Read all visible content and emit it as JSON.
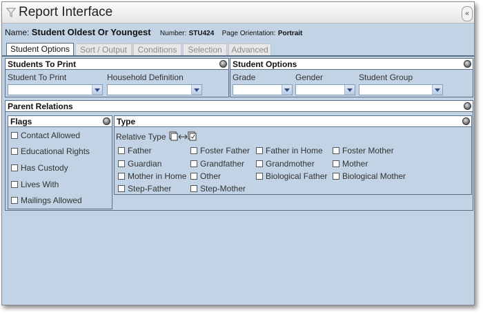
{
  "window": {
    "title": "Report Interface",
    "collapse_label": "«"
  },
  "report": {
    "name_label": "Name:",
    "name": "Student Oldest Or Youngest",
    "number_label": "Number:",
    "number": "STU424",
    "orientation_label": "Page Orientation:",
    "orientation": "Portrait"
  },
  "tabs": [
    {
      "label": "Student Options",
      "active": true
    },
    {
      "label": "Sort / Output",
      "active": false
    },
    {
      "label": "Conditions",
      "active": false
    },
    {
      "label": "Selection",
      "active": false
    },
    {
      "label": "Advanced",
      "active": false
    }
  ],
  "students_to_print": {
    "title": "Students To Print",
    "field1_label": "Student To Print",
    "field1_value": "",
    "field2_label": "Household Definition",
    "field2_value": ""
  },
  "student_options": {
    "title": "Student Options",
    "grade_label": "Grade",
    "grade_value": "",
    "gender_label": "Gender",
    "gender_value": "",
    "group_label": "Student Group",
    "group_value": ""
  },
  "parent_relations": {
    "title": "Parent Relations",
    "flags_title": "Flags",
    "flags": [
      "Contact Allowed",
      "Educational Rights",
      "Has Custody",
      "Lives With",
      "Mailings Allowed"
    ],
    "type_title": "Type",
    "relative_type_label": "Relative Type",
    "relative_types": [
      [
        "Father",
        "Foster Father",
        "Father in Home",
        "Foster Mother"
      ],
      [
        "Guardian",
        "Grandfather",
        "Grandmother",
        "Mother"
      ],
      [
        "Mother in Home",
        "Other",
        "Biological Father",
        "Biological Mother"
      ],
      [
        "Step-Father",
        "Step-Mother"
      ]
    ]
  },
  "colors": {
    "background": "#c1d3e4",
    "border": "#5a6e86",
    "panel_header": "#ffffff"
  }
}
